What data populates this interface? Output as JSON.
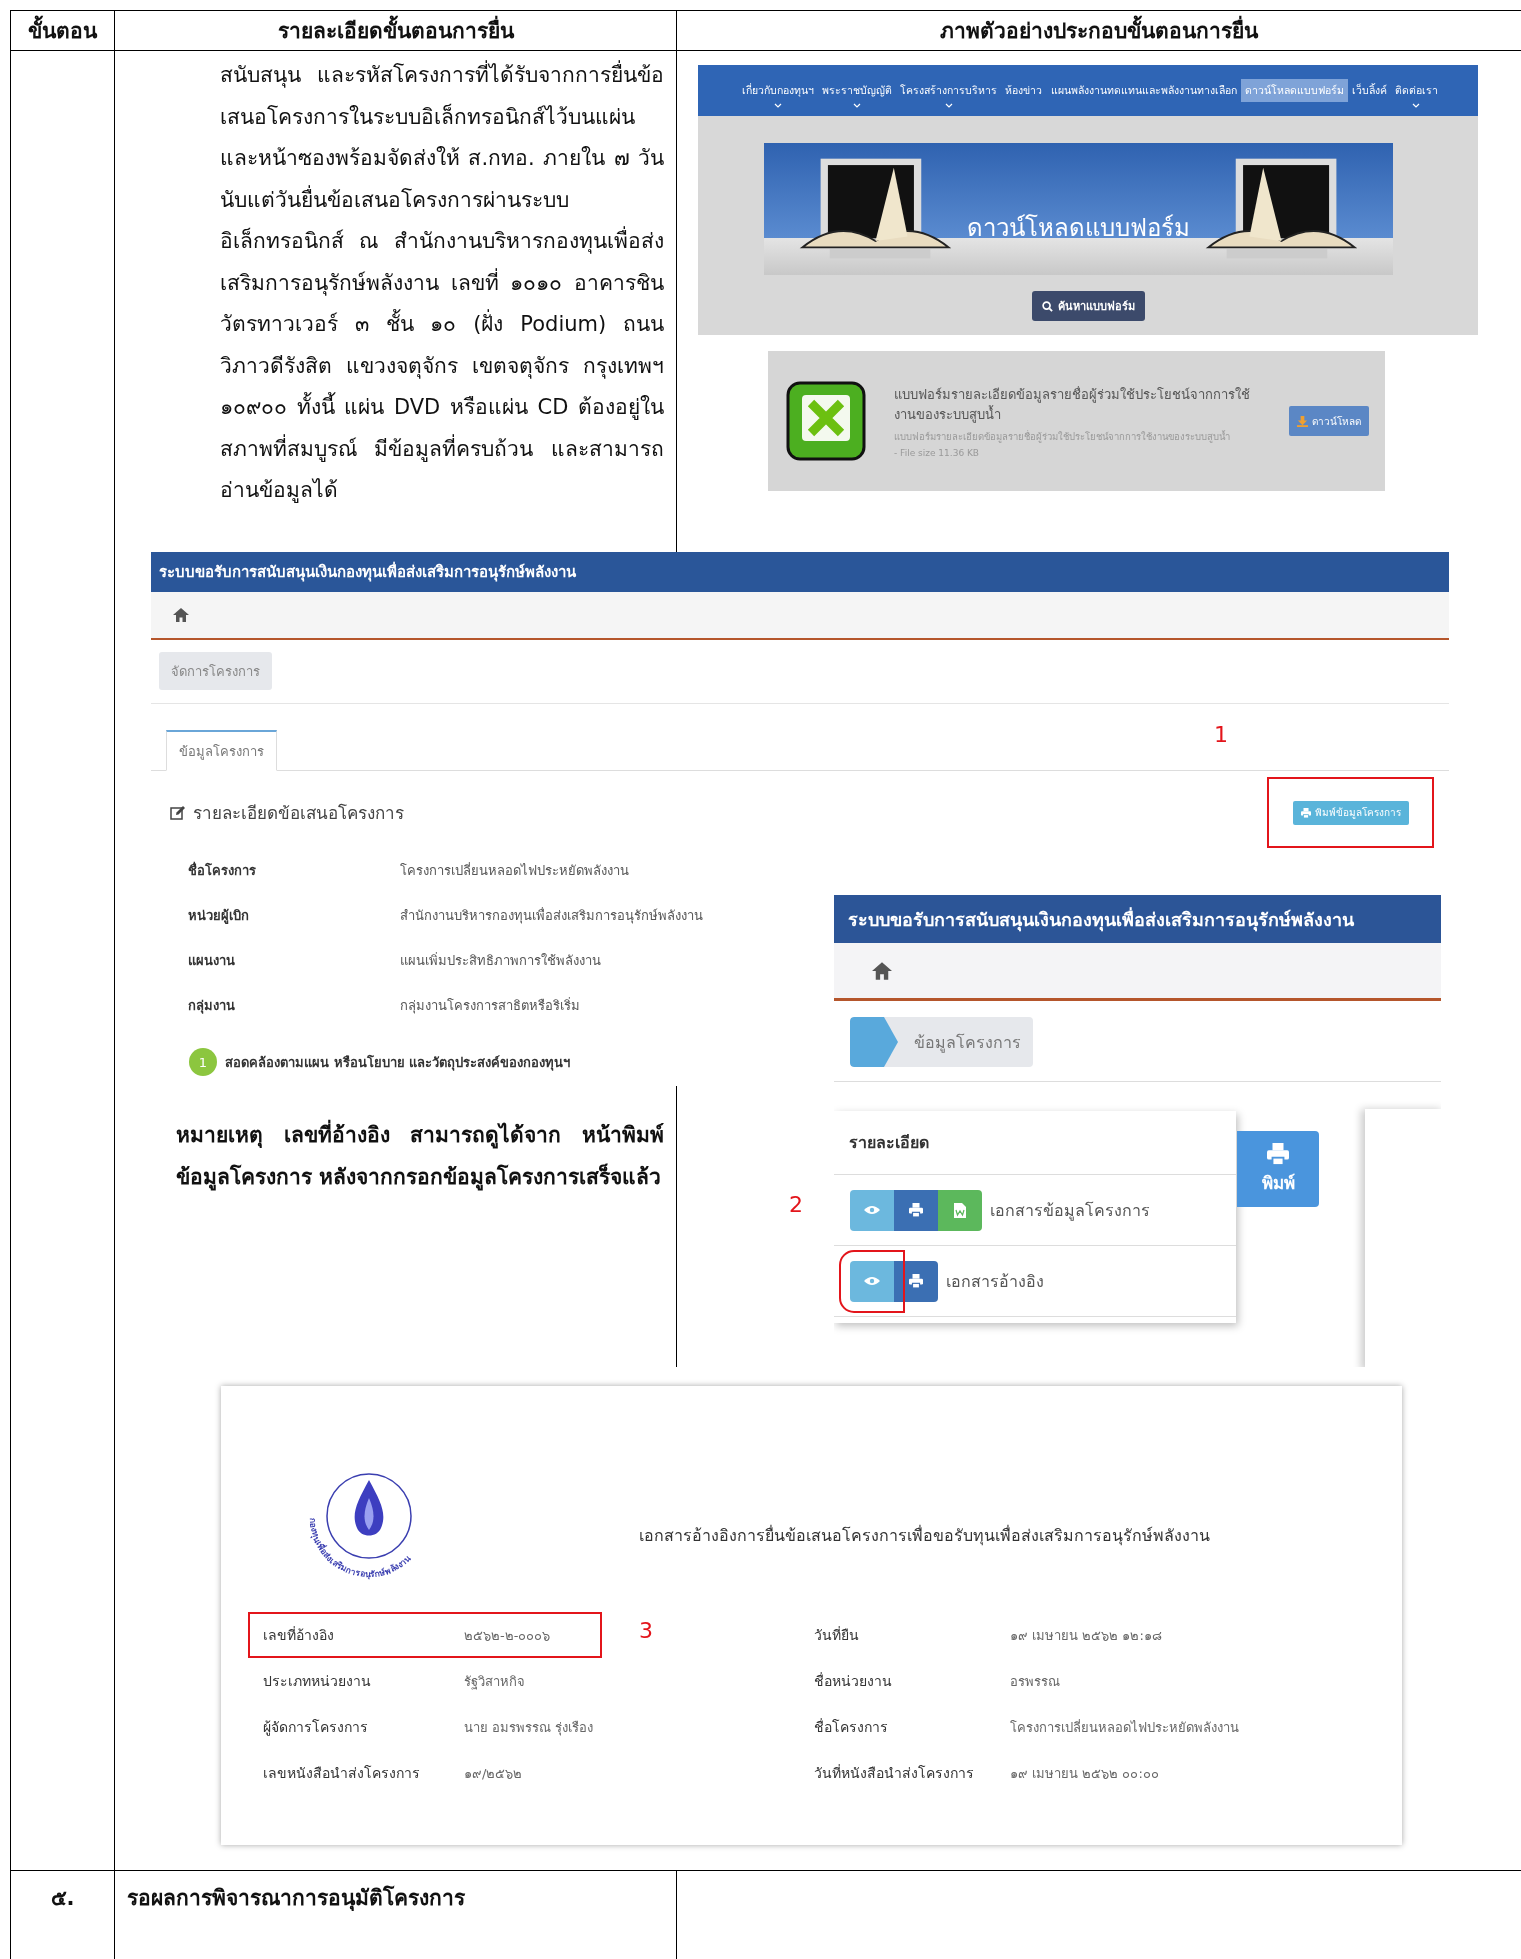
{
  "table": {
    "columns": [
      "ขั้นตอน",
      "รายละเอียดขั้นตอนการยื่น",
      "ภาพตัวอย่างประกอบขั้นตอนการยื่น"
    ],
    "rows": [
      {
        "kind": "illustrated",
        "description": "สนับสนุน และรหัสโครงการที่ได้รับจากการยื่นข้อเสนอโครงการในระบบอิเล็กทรอนิกส์ไว้บนแผ่นและหน้าซองพร้อมจัดส่งให้ ส.กทอ. ภายใน ๗ วันนับแต่วันยื่นข้อเสนอโครงการผ่านระบบอิเล็กทรอนิกส์ ณ สำนักงานบริหารกองทุนเพื่อส่งเสริมการอนุรักษ์พลังงาน เลขที่ ๑๐๑๐ อาคารชินวัตรทาวเวอร์ ๓ ชั้น ๑๐ (ฝั่ง Podium) ถนนวิภาวดีรังสิต แขวงจตุจักร เขตจตุจักร กรุงเทพฯ ๑๐๙๐๐ ทั้งนี้ แผ่น DVD หรือแผ่น CD ต้องอยู่ในสภาพที่สมบูรณ์ มีข้อมูลที่ครบถ้วน และสามารถอ่านข้อมูลได้",
        "note": "หมายเหตุ เลขที่อ้างอิง สามารถดูได้จาก หน้าพิมพ์ข้อมูลโครงการ หลังจากกรอกข้อมูลโครงการเสร็จแล้ว",
        "download_page": {
          "nav": [
            {
              "label": "เกี่ยวกับกองทุนฯ",
              "selected": false,
              "has_dropdown": true
            },
            {
              "label": "พระราชบัญญัติ",
              "selected": false,
              "has_dropdown": true
            },
            {
              "label": "โครงสร้างการบริหาร",
              "selected": false,
              "has_dropdown": true
            },
            {
              "label": "ห้องข่าว",
              "selected": false,
              "has_dropdown": false
            },
            {
              "label": "แผนพลังงานทดแทนและพลังงานทางเลือก",
              "selected": false,
              "has_dropdown": false
            },
            {
              "label": "ดาวน์โหลดแบบฟอร์ม",
              "selected": true,
              "has_dropdown": false
            },
            {
              "label": "เว็บลิ้งค์",
              "selected": false,
              "has_dropdown": false
            },
            {
              "label": "ติดต่อเรา",
              "selected": false,
              "has_dropdown": true
            }
          ],
          "banner_text": "ดาวน์โหลดแบบฟอร์ม",
          "search_button": "ค้นหาแบบฟอร์ม",
          "file": {
            "title": "แบบฟอร์มรายละเอียดข้อมูลรายชื่อผู้ร่วมใช้ประโยชน์จากการใช้งานของระบบสูบน้ำ",
            "description": "แบบฟอร์มรายละเอียดข้อมูลรายชื่อผู้ร่วมใช้ประโยชน์จากการใช้งานของระบบสูบน้ำ",
            "size": "- File size 11.36 KB",
            "download_button": "ดาวน์โหลด"
          }
        },
        "project_screen": {
          "title": "ระบบขอรับการสนับสนุนเงินกองทุนเพื่อส่งเสริมการอนุรักษ์พลังงาน",
          "manage_button": "จัดการโครงการ",
          "tabs": [
            {
              "label": "ข้อมูลโครงการ",
              "selected": true
            }
          ],
          "marker": "1",
          "panel_title": "รายละเอียดข้อเสนอโครงการ",
          "print_button": {
            "label": "พิมพ์ข้อมูลโครงการ",
            "highlighted": true
          },
          "fields": [
            {
              "label": "ชื่อโครงการ",
              "value": "โครงการเปลี่ยนหลอดไฟประหยัดพลังงาน"
            },
            {
              "label": "หน่วยผู้เบิก",
              "value": "สำนักงานบริหารกองทุนเพื่อส่งเสริมการอนุรักษ์พลังงาน"
            },
            {
              "label": "แผนงาน",
              "value": "แผนเพิ่มประสิทธิภาพการใช้พลังงาน"
            },
            {
              "label": "กลุ่มงาน",
              "value": "กลุ่มงานโครงการสาธิตหรือริเริ่ม"
            }
          ],
          "step_badge": "1",
          "step_text": "สอดคล้องตามแผน หรือนโยบาย และวัตถุประสงค์ของกองทุนฯ"
        },
        "documents_screen": {
          "title": "ระบบขอรับการสนับสนุนเงินกองทุนเพื่อส่งเสริมการอนุรักษ์พลังงาน",
          "breadcrumb": "ข้อมูลโครงการ",
          "card_title": "รายละเอียด",
          "print_button": "พิมพ์",
          "marker": "2",
          "documents": [
            {
              "name": "เอกสารข้อมูลโครงการ",
              "actions": [
                {
                  "kind": "view",
                  "highlighted": false
                },
                {
                  "kind": "print",
                  "highlighted": false
                },
                {
                  "kind": "word",
                  "highlighted": false
                }
              ]
            },
            {
              "name": "เอกสารอ้างอิง",
              "actions": [
                {
                  "kind": "view",
                  "highlighted": true
                },
                {
                  "kind": "print",
                  "highlighted": false
                }
              ]
            }
          ]
        },
        "reference_document": {
          "logo_text": "กองทุนเพื่อส่งเสริมการอนุรักษ์พลังงาน",
          "title": "เอกสารอ้างอิงการยื่นข้อเสนอโครงการเพื่อขอรับทุนเพื่อส่งเสริมการอนุรักษ์พลังงาน",
          "marker": "3",
          "fields": [
            {
              "label": "เลขที่อ้างอิง",
              "value": "๒๕๖๒-๒-๐๐๐๖",
              "highlighted": true
            },
            {
              "label": "วันที่ยืน",
              "value": "๑๙ เมษายน ๒๕๖๒ ๑๒:๑๘",
              "highlighted": false
            },
            {
              "label": "ประเภทหน่วยงาน",
              "value": "รัฐวิสาหกิจ",
              "highlighted": false
            },
            {
              "label": "ชื่อหน่วยงาน",
              "value": "อรพรรณ",
              "highlighted": false
            },
            {
              "label": "ผู้จัดการโครงการ",
              "value": "นาย อมรพรรณ รุ่งเรือง",
              "highlighted": false
            },
            {
              "label": "ชื่อโครงการ",
              "value": "โครงการเปลี่ยนหลอดไฟประหยัดพลังงาน",
              "highlighted": false
            },
            {
              "label": "เลขหนังสือนำส่งโครงการ",
              "value": "๑๙/๒๕๖๒",
              "highlighted": false
            },
            {
              "label": "วันที่หนังสือนำส่งโครงการ",
              "value": "๑๙ เมษายน ๒๕๖๒ ๐๐:๐๐",
              "highlighted": false
            }
          ]
        }
      },
      {
        "kind": "plain",
        "step": "๕.",
        "description": "รอผลการพิจารณาการอนุมัติโครงการ"
      }
    ]
  }
}
